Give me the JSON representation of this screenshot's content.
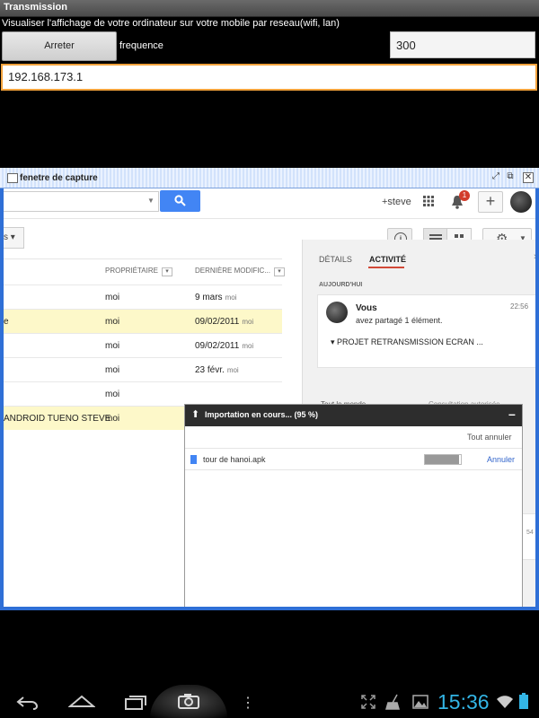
{
  "app": {
    "title": "Transmission",
    "description": "Visualiser l'affichage de votre ordinateur sur votre mobile par reseau(wifi, lan)",
    "stop_button": "Arreter",
    "frequency_label": "frequence",
    "frequency_value": "300",
    "ip_value": "192.168.173.1"
  },
  "capture_window": {
    "title": "fenetre de capture",
    "drive": {
      "user": "+steve",
      "notification_count": "1",
      "filter_caret": "s",
      "columns": {
        "owner": "PROPRIÉTAIRE",
        "modified": "DERNIÈRE MODIFIC..."
      },
      "rows": [
        {
          "name": "",
          "owner": "moi",
          "date": "9 mars",
          "by": "moi",
          "highlight": false
        },
        {
          "name": "e",
          "owner": "moi",
          "date": "09/02/2011",
          "by": "moi",
          "highlight": true
        },
        {
          "name": "",
          "owner": "moi",
          "date": "09/02/2011",
          "by": "moi",
          "highlight": false
        },
        {
          "name": "",
          "owner": "moi",
          "date": "23 févr.",
          "by": "moi",
          "highlight": false
        },
        {
          "name": "",
          "owner": "moi",
          "date": "",
          "by": "",
          "highlight": false
        },
        {
          "name": "ANDROID TUENO STEVE",
          "owner": "moi",
          "date": "",
          "by": "",
          "highlight": true
        }
      ],
      "panel": {
        "tab_details": "DÉTAILS",
        "tab_activity": "ACTIVITÉ",
        "today_label": "AUJOURD'HUI",
        "activity": {
          "who": "Vous",
          "time": "22:56",
          "action": "avez partagé 1 élément.",
          "file": "PROJET RETRANSMISSION ECRAN ..."
        },
        "partial_left": "Tout le monde",
        "partial_right": "Consultation autorisée",
        "partial_time": "54"
      },
      "upload": {
        "title": "Importation en cours... (95 %)",
        "cancel_all": "Tout annuler",
        "file": "tour de hanoi.apk",
        "progress": 95,
        "cancel": "Annuler"
      }
    }
  },
  "statusbar": {
    "time": "15:36"
  }
}
